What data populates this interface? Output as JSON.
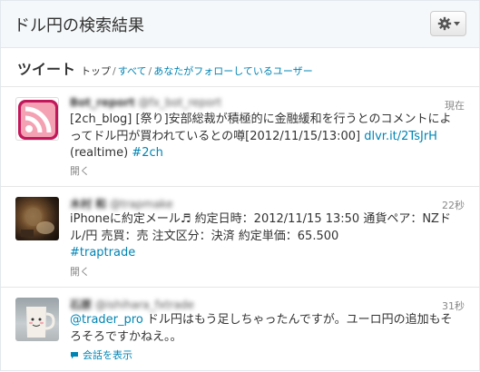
{
  "header": {
    "title": "ドル円の検索結果"
  },
  "tabs": {
    "title": "ツイート",
    "items": [
      {
        "label": "トップ"
      },
      {
        "label": "すべて"
      },
      {
        "label": "あなたがフォローしているユーザー"
      }
    ],
    "separator": "/"
  },
  "tweets": [
    {
      "user_name": "Bot_report",
      "user_handle": "@fx_bot_report",
      "time": "現在",
      "text_main": "[2ch_blog] [祭り]安部総裁が積極的に金融緩和を行うとのコメントによってドル円が買われているとの噂[2012/11/15/13:00] ",
      "link": "dlvr.it/2TsJrH",
      "text_after": " (realtime) ",
      "hashtag": "#2ch",
      "action": "開く"
    },
    {
      "user_name": "木村 和",
      "user_handle": "@trapmake",
      "time": "22秒",
      "line1": "iPhoneに約定メール♬ 約定日時：2012/11/15 13:50 通貨ペア：NZドル/円 売買：売 注文区分：決済 約定単価：65.500",
      "hashtag": "#traptrade",
      "action": "開く"
    },
    {
      "user_name": "石原",
      "user_handle": "@ishihara_fxtrade",
      "time": "31秒",
      "mention": "@trader_pro",
      "text": " ドル円はもう足しちゃったんですが。ユーロ円の追加もそろそろですかねえ。。",
      "action": "会話を表示"
    }
  ],
  "colors": {
    "link": "#0084b4",
    "rss_orange": "#f4a1b3"
  }
}
